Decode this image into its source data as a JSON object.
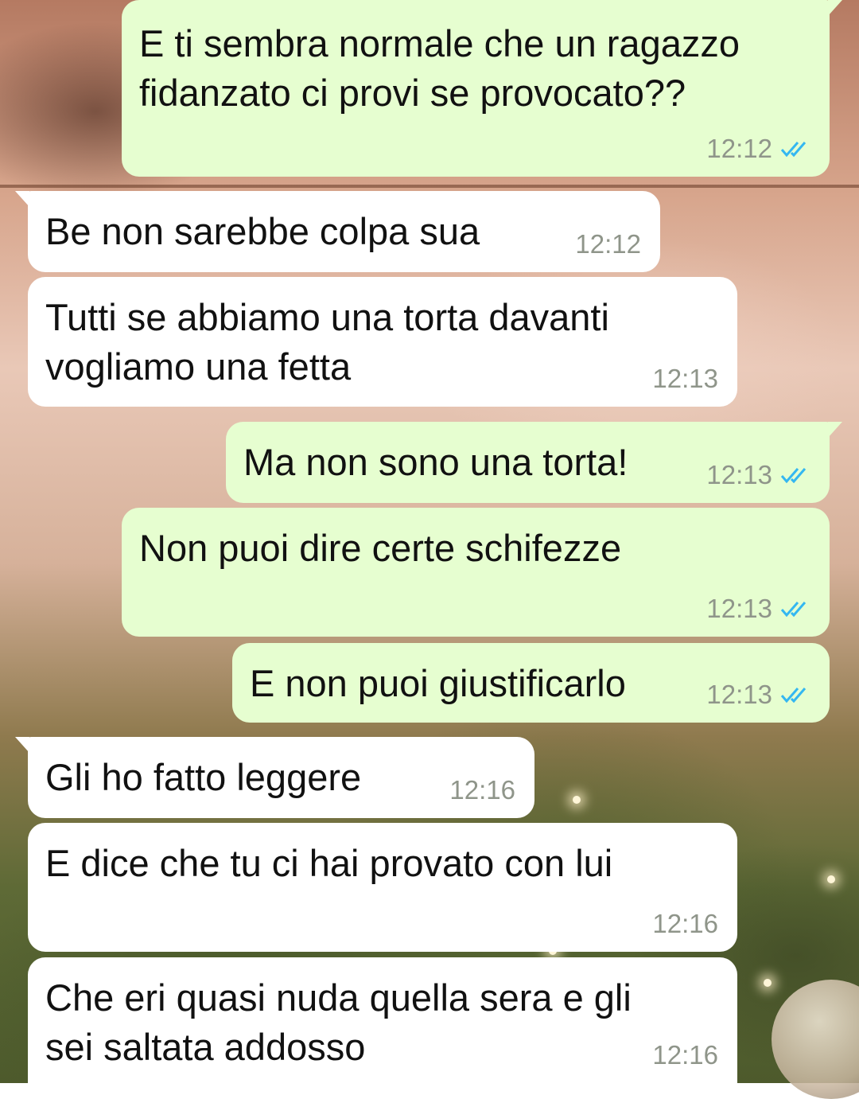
{
  "conversation": {
    "colors": {
      "outgoing_bubble": "#e6fed0",
      "incoming_bubble": "#ffffff",
      "timestamp": "#8f958a",
      "read_ticks": "#34b7f1"
    },
    "messages": [
      {
        "direction": "outgoing",
        "text": "E ti sembra normale che un ragazzo\nfidanzato ci provi se provocato??",
        "time": "12:12",
        "status_icon": "double-check-read-icon"
      },
      {
        "direction": "incoming",
        "text": "Be non sarebbe colpa sua",
        "time": "12:12"
      },
      {
        "direction": "incoming",
        "text": "Tutti se abbiamo una torta davanti\nvogliamo una fetta",
        "time": "12:13"
      },
      {
        "direction": "outgoing",
        "text": "Ma non sono una torta!",
        "time": "12:13",
        "status_icon": "double-check-read-icon"
      },
      {
        "direction": "outgoing",
        "text": "Non puoi dire certe schifezze",
        "time": "12:13",
        "status_icon": "double-check-read-icon"
      },
      {
        "direction": "outgoing",
        "text": "E non puoi giustificarlo",
        "time": "12:13",
        "status_icon": "double-check-read-icon"
      },
      {
        "direction": "incoming",
        "text": "Gli ho fatto leggere",
        "time": "12:16"
      },
      {
        "direction": "incoming",
        "text": "E dice che tu ci hai provato con lui",
        "time": "12:16"
      },
      {
        "direction": "incoming",
        "text": "Che eri quasi nuda quella sera e gli\nsei saltata addosso",
        "time": "12:16"
      }
    ]
  }
}
